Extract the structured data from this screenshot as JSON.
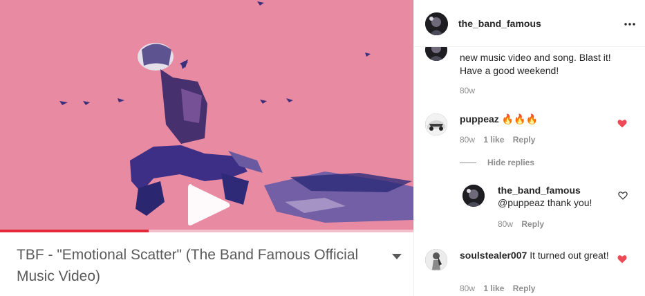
{
  "video": {
    "title": "TBF - \"Emotional Scatter\" (The Band Famous Official Music Video)",
    "progress_fraction": 0.36,
    "background_color": "#e98aa3",
    "progress_color": "#e5283a"
  },
  "post": {
    "author": "the_band_famous",
    "more_icon": "more-horizontal-icon",
    "caption": {
      "text": "new music video and song. Blast it! Have a good weekend!",
      "time": "80w"
    },
    "comments": [
      {
        "username": "puppeaz",
        "text": "🔥🔥🔥",
        "time": "80w",
        "likes": "1 like",
        "reply_label": "Reply",
        "liked": true
      },
      {
        "username": "soulstealer007",
        "text": "It turned out great!",
        "time": "80w",
        "likes": "1 like",
        "reply_label": "Reply",
        "liked": true
      }
    ],
    "hide_replies_label": "Hide replies",
    "reply": {
      "username": "the_band_famous",
      "text": "@puppeaz thank you!",
      "time": "80w",
      "reply_label": "Reply",
      "liked": false
    },
    "colors": {
      "heart_liked": "#ed4956",
      "muted_text": "#8e8e8e"
    }
  }
}
